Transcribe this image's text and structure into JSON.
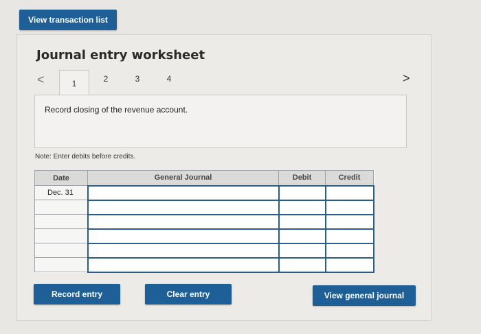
{
  "header": {
    "view_transactions_label": "View transaction list"
  },
  "worksheet": {
    "title": "Journal entry worksheet",
    "tabs": [
      "1",
      "2",
      "3",
      "4"
    ],
    "active_tab": "1",
    "prev_glyph": "<",
    "next_glyph": ">",
    "instruction": "Record closing of the revenue account.",
    "note": "Note: Enter debits before credits."
  },
  "table": {
    "headers": {
      "date": "Date",
      "general_journal": "General Journal",
      "debit": "Debit",
      "credit": "Credit"
    },
    "rows": [
      {
        "date": "Dec. 31",
        "account": "",
        "debit": "",
        "credit": ""
      },
      {
        "date": "",
        "account": "",
        "debit": "",
        "credit": ""
      },
      {
        "date": "",
        "account": "",
        "debit": "",
        "credit": ""
      },
      {
        "date": "",
        "account": "",
        "debit": "",
        "credit": ""
      },
      {
        "date": "",
        "account": "",
        "debit": "",
        "credit": ""
      },
      {
        "date": "",
        "account": "",
        "debit": "",
        "credit": ""
      }
    ]
  },
  "actions": {
    "record_label": "Record entry",
    "clear_label": "Clear entry",
    "view_journal_label": "View general journal"
  },
  "colors": {
    "button": "#1f5f97",
    "input_border": "#2c5d87"
  }
}
